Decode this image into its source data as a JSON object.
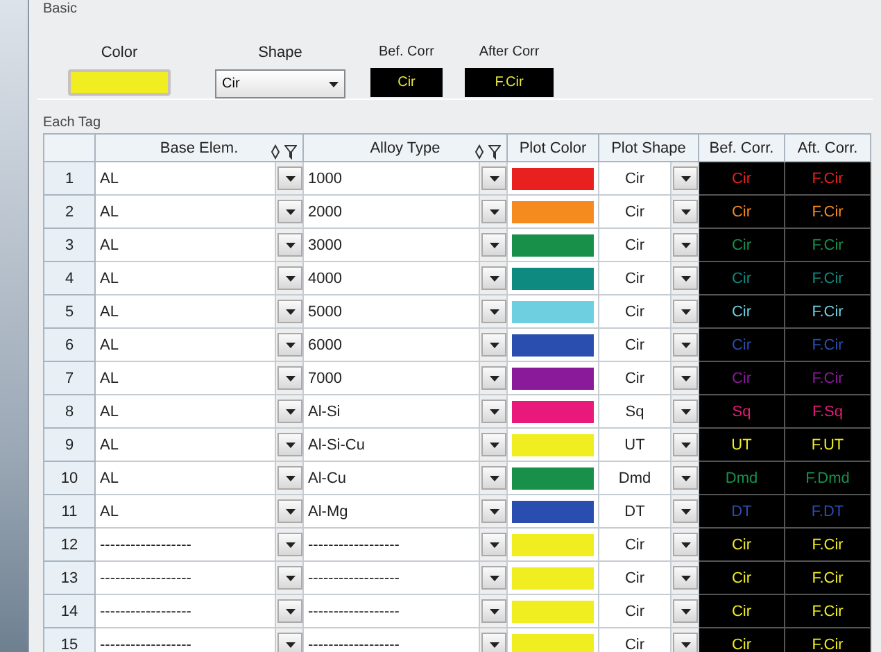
{
  "basic": {
    "title": "Basic",
    "color_label": "Color",
    "color": "#f0ee20",
    "shape_label": "Shape",
    "shape": "Cir",
    "bef_label": "Bef. Corr",
    "bef": "Cir",
    "aft_label": "After Corr",
    "aft": "F.Cir"
  },
  "each_tag": {
    "title": "Each Tag",
    "columns": [
      "Base Elem.",
      "Alloy Type",
      "Plot Color",
      "Plot Shape",
      "Bef. Corr.",
      "Aft. Corr."
    ],
    "rows": [
      {
        "num": "1",
        "base": "AL",
        "alloy": "1000",
        "color": "#e82020",
        "shape": "Cir",
        "bef": "Cir",
        "aft": "F.Cir"
      },
      {
        "num": "2",
        "base": "AL",
        "alloy": "2000",
        "color": "#f58a1f",
        "shape": "Cir",
        "bef": "Cir",
        "aft": "F.Cir"
      },
      {
        "num": "3",
        "base": "AL",
        "alloy": "3000",
        "color": "#18904a",
        "shape": "Cir",
        "bef": "Cir",
        "aft": "F.Cir"
      },
      {
        "num": "4",
        "base": "AL",
        "alloy": "4000",
        "color": "#0f8a80",
        "shape": "Cir",
        "bef": "Cir",
        "aft": "F.Cir"
      },
      {
        "num": "5",
        "base": "AL",
        "alloy": "5000",
        "color": "#6ecfe0",
        "shape": "Cir",
        "bef": "Cir",
        "aft": "F.Cir"
      },
      {
        "num": "6",
        "base": "AL",
        "alloy": "6000",
        "color": "#2a4db0",
        "shape": "Cir",
        "bef": "Cir",
        "aft": "F.Cir"
      },
      {
        "num": "7",
        "base": "AL",
        "alloy": "7000",
        "color": "#8a1a9a",
        "shape": "Cir",
        "bef": "Cir",
        "aft": "F.Cir"
      },
      {
        "num": "8",
        "base": "AL",
        "alloy": "Al-Si",
        "color": "#e8197a",
        "shape": "Sq",
        "bef": "Sq",
        "aft": "F.Sq"
      },
      {
        "num": "9",
        "base": "AL",
        "alloy": "Al-Si-Cu",
        "color": "#f0ee20",
        "shape": "UT",
        "bef": "UT",
        "aft": "F.UT"
      },
      {
        "num": "10",
        "base": "AL",
        "alloy": "Al-Cu",
        "color": "#18904a",
        "shape": "Dmd",
        "bef": "Dmd",
        "aft": "F.Dmd"
      },
      {
        "num": "11",
        "base": "AL",
        "alloy": "Al-Mg",
        "color": "#2a4db0",
        "shape": "DT",
        "bef": "DT",
        "aft": "F.DT"
      },
      {
        "num": "12",
        "base": "------------------",
        "alloy": "------------------",
        "color": "#f0ee20",
        "shape": "Cir",
        "bef": "Cir",
        "aft": "F.Cir"
      },
      {
        "num": "13",
        "base": "------------------",
        "alloy": "------------------",
        "color": "#f0ee20",
        "shape": "Cir",
        "bef": "Cir",
        "aft": "F.Cir"
      },
      {
        "num": "14",
        "base": "------------------",
        "alloy": "------------------",
        "color": "#f0ee20",
        "shape": "Cir",
        "bef": "Cir",
        "aft": "F.Cir"
      },
      {
        "num": "15",
        "base": "------------------",
        "alloy": "------------------",
        "color": "#f0ee20",
        "shape": "Cir",
        "bef": "Cir",
        "aft": "F.Cir"
      }
    ]
  }
}
